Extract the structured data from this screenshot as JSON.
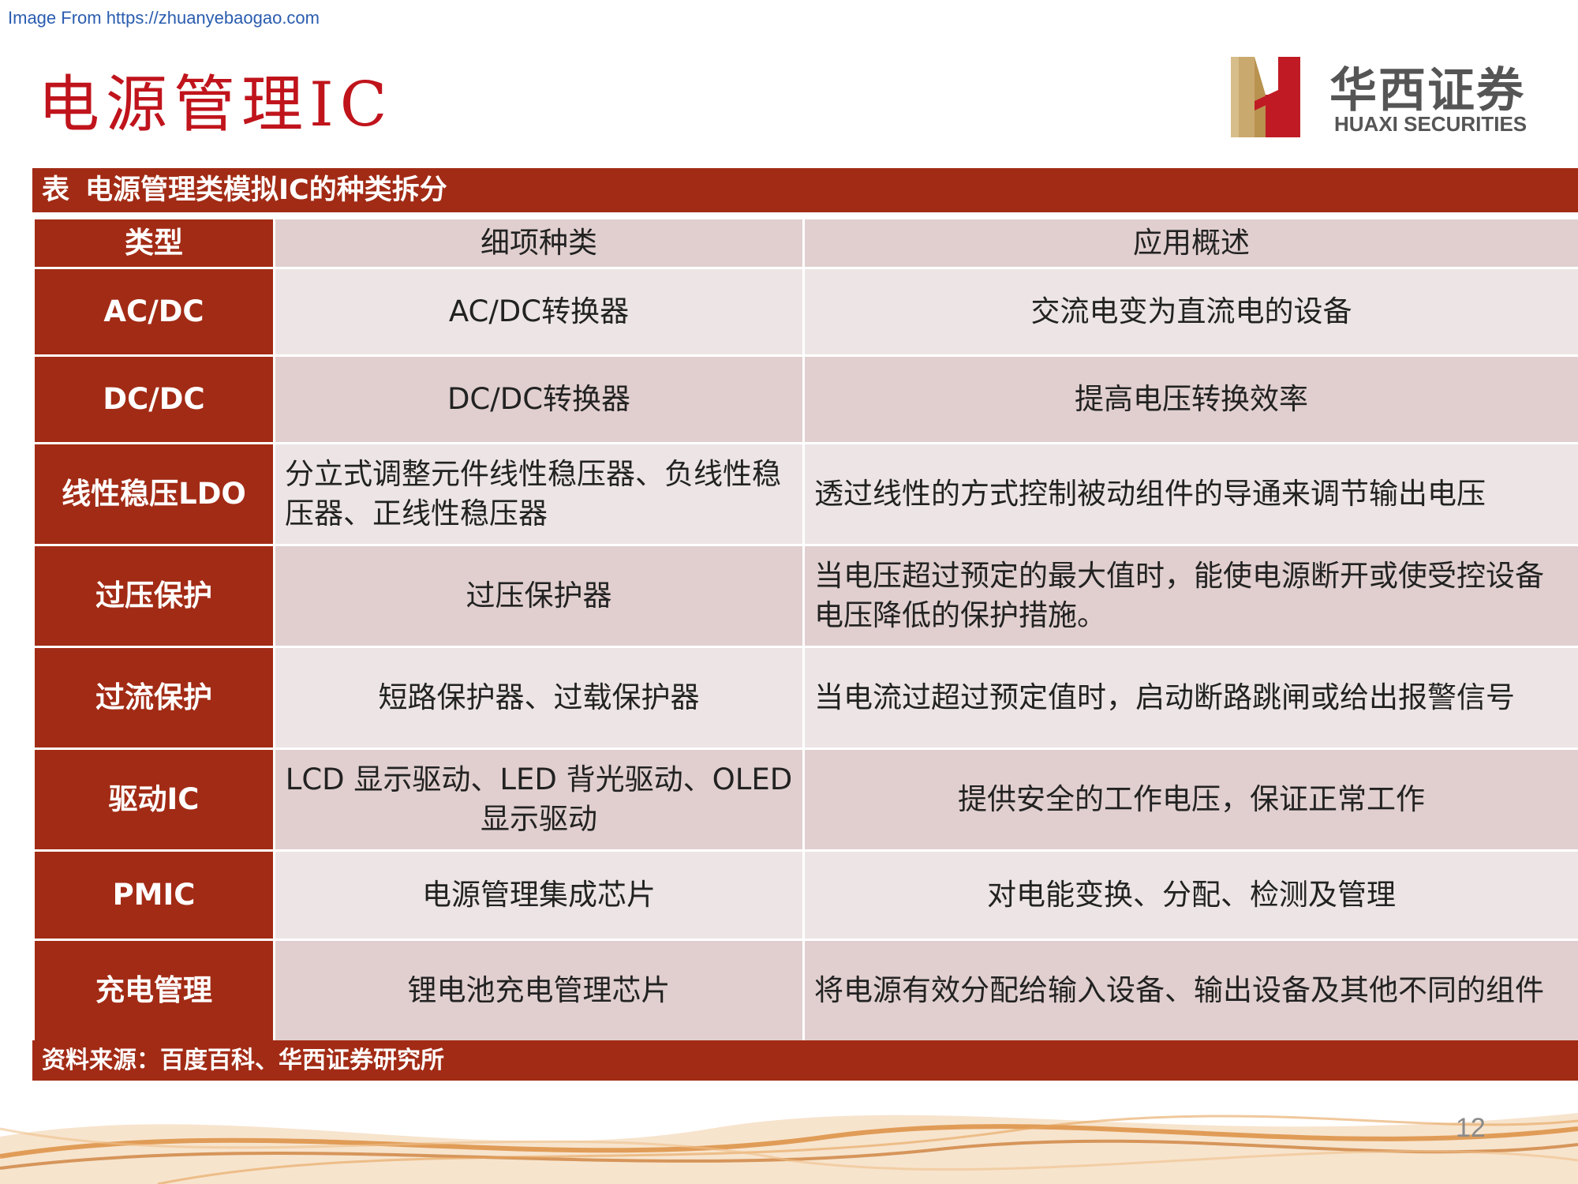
{
  "watermark": "Image From https://zhuanyebaogao.com",
  "page_title": "电源管理IC",
  "logo": {
    "name_cn": "华西证券",
    "name_en": "HUAXI SECURITIES",
    "icon": "huaxi-logo-icon"
  },
  "table": {
    "caption_prefix": "表",
    "caption_title": "电源管理类模拟IC的种类拆分",
    "headers": [
      "类型",
      "细项种类",
      "应用概述"
    ],
    "rows": [
      [
        "AC/DC",
        "AC/DC转换器",
        "交流电变为直流电的设备"
      ],
      [
        "DC/DC",
        "DC/DC转换器",
        "提高电压转换效率"
      ],
      [
        "线性稳压LDO",
        "分立式调整元件线性稳压器、负线性稳压器、正线性稳压器",
        "透过线性的方式控制被动组件的导通来调节输出电压"
      ],
      [
        "过压保护",
        "过压保护器",
        "当电压超过预定的最大值时，能使电源断开或使受控设备电压降低的保护措施。"
      ],
      [
        "过流保护",
        "短路保护器、过载保护器",
        "当电流过超过预定值时，启动断路跳闸或给出报警信号"
      ],
      [
        "驱动IC",
        "LCD 显示驱动、LED 背光驱动、OLED 显示驱动",
        "提供安全的工作电压，保证正常工作"
      ],
      [
        "PMIC",
        "电源管理集成芯片",
        "对电能变换、分配、检测及管理"
      ],
      [
        "充电管理",
        "锂电池充电管理芯片",
        "将电源有效分配给输入设备、输出设备及其他不同的组件"
      ]
    ]
  },
  "source": "资料来源：百度百科、华西证券研究所",
  "page_number": "12",
  "colors": {
    "accent": "#a22b15",
    "title_red": "#c0141c",
    "row_dark": "#e1cfcf",
    "row_light": "#ede5e5",
    "wave": "#d9893a"
  }
}
